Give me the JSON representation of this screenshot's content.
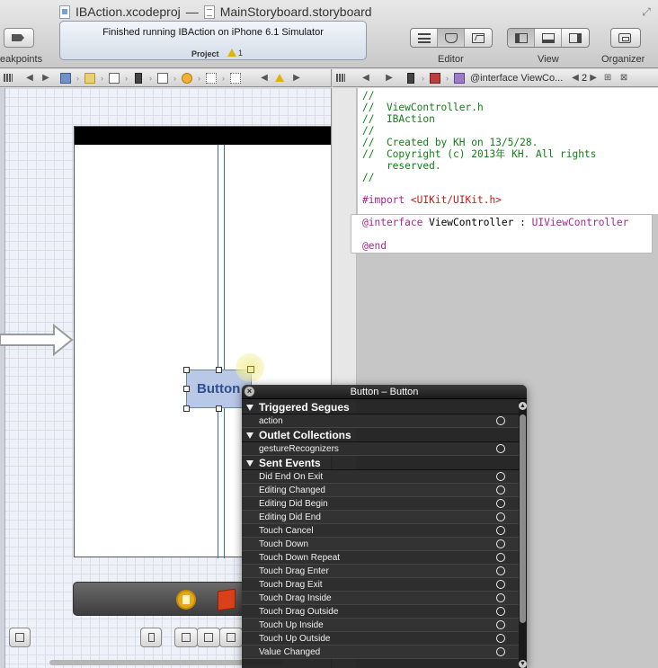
{
  "window": {
    "project_tab": "IBAction.xcodeproj",
    "separator": "—",
    "file_tab": "MainStoryboard.storyboard"
  },
  "toolbar": {
    "breakpoints_label": "eakpoints",
    "activity": {
      "status": "Finished running IBAction on iPhone 6.1 Simulator",
      "project_label": "Project",
      "warning_count": "1"
    },
    "editor_label": "Editor",
    "view_label": "View",
    "organizer_label": "Organizer"
  },
  "jumpbar_right": {
    "interface_label": "@interface ViewCo...",
    "counterpart_index": "2"
  },
  "storyboard": {
    "button_title": "Button"
  },
  "code": {
    "lines_top": [
      "//",
      "//  ViewController.h",
      "//  IBAction",
      "//",
      "//  Created by KH on 13/5/28.",
      "//  Copyright (c) 2013年 KH. All rights",
      "    reserved.",
      "//"
    ],
    "import_directive": "#import ",
    "import_target": "<UIKit/UIKit.h>",
    "interface_kw": "@interface",
    "interface_name": " ViewController : ",
    "superclass": "UIViewController",
    "end_kw": "@end"
  },
  "hud": {
    "title": "Button – Button",
    "close_glyph": "×",
    "sections": [
      {
        "title": "Triggered Segues",
        "items": [
          "action"
        ]
      },
      {
        "title": "Outlet Collections",
        "items": [
          "gestureRecognizers"
        ]
      },
      {
        "title": "Sent Events",
        "items": [
          "Did End On Exit",
          "Editing Changed",
          "Editing Did Begin",
          "Editing Did End",
          "Touch Cancel",
          "Touch Down",
          "Touch Down Repeat",
          "Touch Drag Enter",
          "Touch Drag Exit",
          "Touch Drag Inside",
          "Touch Drag Outside",
          "Touch Up Inside",
          "Touch Up Outside",
          "Value Changed"
        ]
      }
    ]
  },
  "colors": {
    "comment": "#117e17",
    "keyword": "#a6258f",
    "string": "#c41a16",
    "selection_blue": "#3b6fb5",
    "hud_background": "#1c1c1c"
  }
}
